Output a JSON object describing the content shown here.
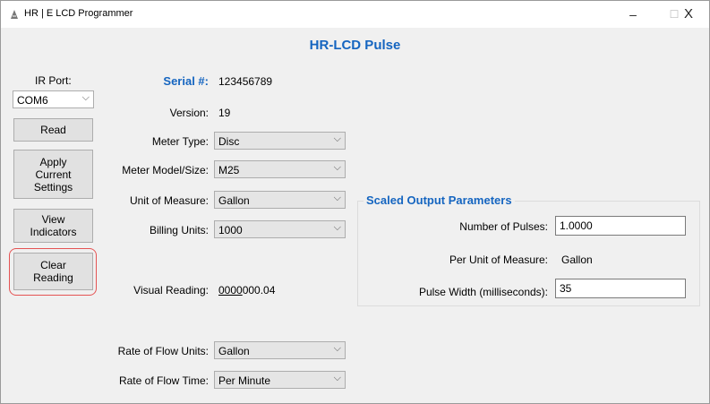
{
  "window": {
    "title": "HR | E LCD Programmer",
    "controls": {
      "minimize": "–",
      "maximize": "☐",
      "close": "X"
    }
  },
  "form_title": "HR-LCD Pulse",
  "ir_port": {
    "label": "IR Port:",
    "value": "COM6"
  },
  "buttons": {
    "read": "Read",
    "apply_line1": "Apply",
    "apply_line2": "Current",
    "apply_line3": "Settings",
    "view_line1": "View",
    "view_line2": "Indicators",
    "clear_line1": "Clear",
    "clear_line2": "Reading"
  },
  "serial": {
    "label": "Serial #:",
    "value": "123456789"
  },
  "version": {
    "label": "Version:",
    "value": "19"
  },
  "meter_type": {
    "label": "Meter Type:",
    "value": "Disc"
  },
  "meter_model": {
    "label": "Meter Model/Size:",
    "value": "M25"
  },
  "unit_of_measure": {
    "label": "Unit of Measure:",
    "value": "Gallon"
  },
  "billing_units": {
    "label": "Billing Units:",
    "value": "1000"
  },
  "visual_reading": {
    "label": "Visual Reading:",
    "value_underlined": "0000",
    "value_rest": "000.04"
  },
  "rate_of_flow_units": {
    "label": "Rate of Flow Units:",
    "value": "Gallon"
  },
  "rate_of_flow_time": {
    "label": "Rate of Flow Time:",
    "value": "Per Minute"
  },
  "scaled_output": {
    "title": "Scaled Output Parameters",
    "number_of_pulses": {
      "label": "Number of Pulses:",
      "value": "1.0000"
    },
    "per_unit_of_measure": {
      "label": "Per Unit of Measure:",
      "value": "Gallon"
    },
    "pulse_width": {
      "label": "Pulse Width (milliseconds):",
      "value": "35"
    }
  },
  "colors": {
    "accent": "#1565c0",
    "highlight": "#e55353"
  }
}
